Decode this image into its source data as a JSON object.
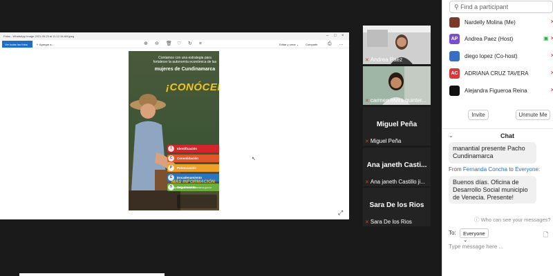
{
  "shared_window": {
    "title": "Fotos - WhatsApp Image 2021-09-23 at 11.12.34 AM.jpeg",
    "see_all_label": "Ver todas las fotos",
    "add_to_label": "Agregar a...",
    "edit_label": "Editar y crear",
    "share_label": "Compartir"
  },
  "poster": {
    "heading": "Contamos con una estrategia para fortalecer la autonomía económica de las",
    "heading_strong": "mujeres de Cundinamarca",
    "call": "¡CONÓCELA!",
    "steps": [
      {
        "letter": "I",
        "label": "Identificación",
        "color": "#d2262b"
      },
      {
        "letter": "C",
        "label": "Consolidación",
        "color": "#e2572a"
      },
      {
        "letter": "P",
        "label": "Potenciación",
        "color": "#eea12a"
      },
      {
        "letter": "E",
        "label": "Encadenamiento",
        "color": "#2b75c0"
      },
      {
        "letter": "S",
        "label": "Seguimiento",
        "color": "#6cae3d"
      }
    ],
    "more_info": "MÁS INFORMACIÓN",
    "url": "dirgrupoautonomiacundinamarca.gov.co"
  },
  "tiles": [
    {
      "name": "Andrea Paez",
      "type": "video"
    },
    {
      "name": "carmen elvira quinter...",
      "type": "video"
    },
    {
      "name": "Miguel Peña",
      "big": "Miguel Peña",
      "type": "name"
    },
    {
      "name": "Ana janeth Castillo ji...",
      "big": "Ana janeth Casti...",
      "type": "name"
    },
    {
      "name": "Sara De los Rios",
      "big": "Sara De los Rios",
      "type": "name"
    }
  ],
  "sidebar": {
    "search_placeholder": "Find a participant",
    "participants": [
      {
        "name": "Nardelly Molina (Me)",
        "initials": "",
        "color": "#7a3a2a"
      },
      {
        "name": "Andrea Paez (Host)",
        "initials": "AP",
        "color": "#7b4fc9"
      },
      {
        "name": "diego lopez (Co-host)",
        "initials": "",
        "color": "#3a6ec0"
      },
      {
        "name": "ADRIANA CRUZ TAVERA",
        "initials": "AC",
        "color": "#d43a3a"
      },
      {
        "name": "Alejandra Figueroa Reina",
        "initials": "",
        "color": "#111111"
      }
    ],
    "invite_label": "Invite",
    "unmute_label": "Unmute Me"
  },
  "chat": {
    "title": "Chat",
    "prev_message": "manantial presente Pacho Cundinamarca",
    "from_prefix": "From",
    "from_name": "Fernanda Concha",
    "to_word": "to",
    "to_name": "Everyone",
    "message": "Buenos días. Oficina de Desarrollo Social municipio de Venecia. Presente!",
    "visibility_note": "Who can see your messages?",
    "to_label": "To:",
    "recipient": "Everyone",
    "input_placeholder": "Type message here ..."
  }
}
